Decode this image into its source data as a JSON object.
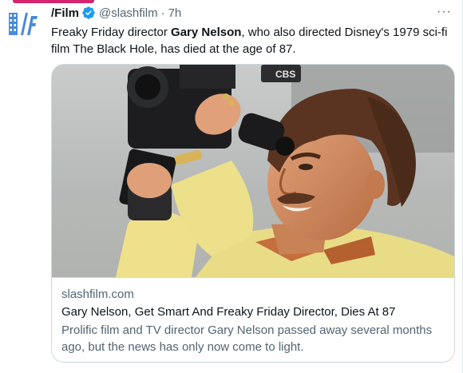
{
  "tweet": {
    "author_name": "/Film",
    "handle": "@slashfilm",
    "separator": "·",
    "time": "7h",
    "more_label": "···",
    "text_before": "Freaky Friday director ",
    "text_bold": "Gary Nelson",
    "text_after": ", who also directed Disney's 1979 sci-fi film The Black Hole, has died at the age of 87."
  },
  "card": {
    "domain": "slashfilm.com",
    "title": "Gary Nelson, Get Smart And Freaky Friday Director, Dies At 87",
    "description": "Prolific film and TV director Gary Nelson passed away several months ago, but the news has only now come to light.",
    "image_logo_text": "CBS"
  },
  "colors": {
    "text_primary": "#0f1419",
    "text_secondary": "#536471",
    "verified_blue": "#1d9bf0",
    "border": "#cfd9de",
    "logo_blue": "#4a8bd6"
  },
  "icons": {
    "avatar": "slashfilm-logo-icon",
    "verified": "verified-badge-icon",
    "more": "more-icon"
  }
}
